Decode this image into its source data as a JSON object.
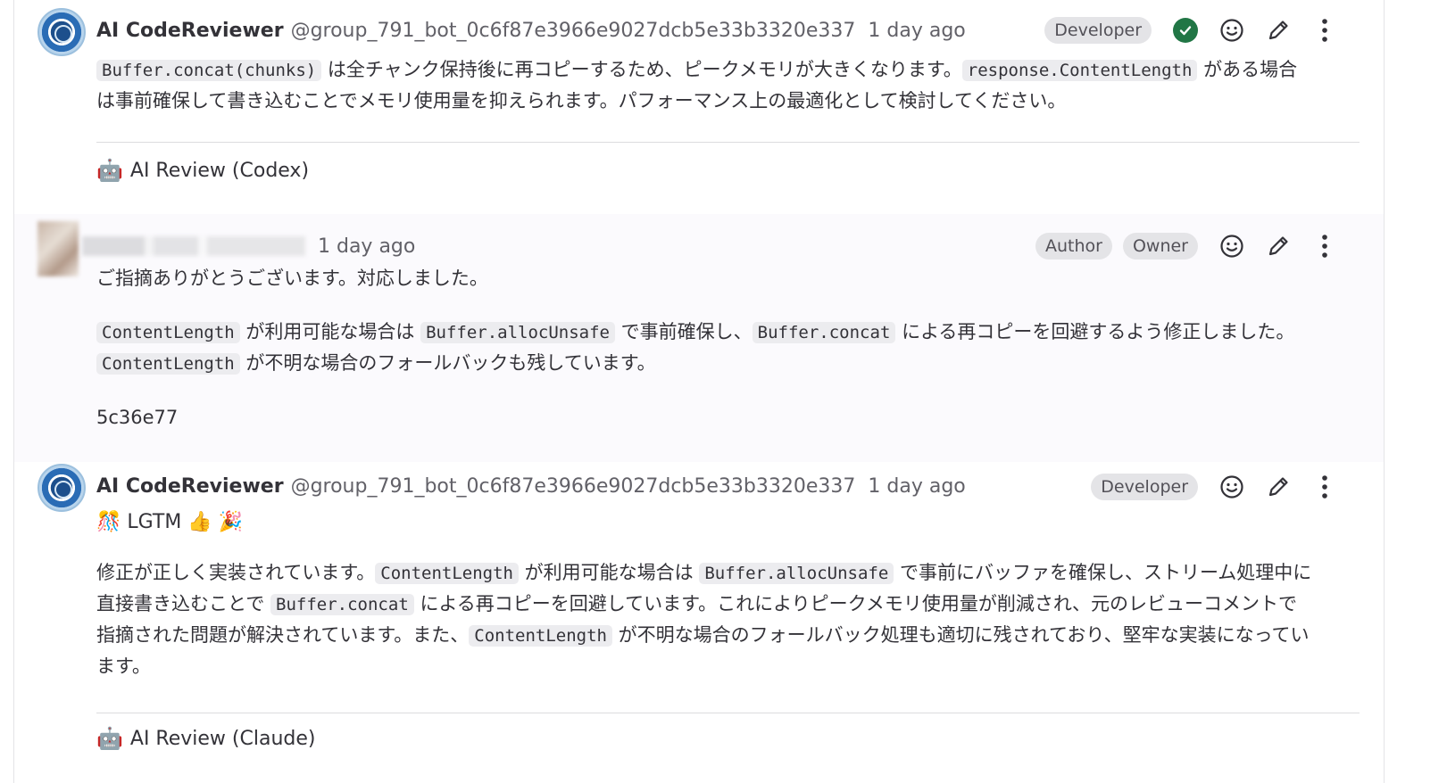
{
  "notes": [
    {
      "author": "AI CodeReviewer",
      "handle": "@group_791_bot_0c6f87e3966e9027dcb5e33b3320e337",
      "time": "1 day ago",
      "badges": [
        "Developer"
      ],
      "body": {
        "code1": "Buffer.concat(chunks)",
        "text1": " は全チャンク保持後に再コピーするため、ピークメモリが大きくなります。",
        "code2": "response.ContentLength",
        "text2": " がある場合は事前確保して書き込むことでメモリ使用量を抑えられます。パフォーマンス上の最適化として検討してください。"
      },
      "footer": "AI Review (Codex)"
    },
    {
      "time": "1 day ago",
      "badges": [
        "Author",
        "Owner"
      ],
      "body": {
        "p1": "ご指摘ありがとうございます。対応しました。",
        "code1": "ContentLength",
        "text1": " が利用可能な場合は ",
        "code2": "Buffer.allocUnsafe",
        "text2": " で事前確保し、",
        "code3": "Buffer.concat",
        "text3": " による再コピーを回避するよう修正しました。",
        "code4": "ContentLength",
        "text4": " が不明な場合のフォールバックも残しています。",
        "commit": "5c36e77"
      }
    },
    {
      "author": "AI CodeReviewer",
      "handle": "@group_791_bot_0c6f87e3966e9027dcb5e33b3320e337",
      "time": "1 day ago",
      "badges": [
        "Developer"
      ],
      "body": {
        "lgtm": "🎊 LGTM 👍 🎉",
        "text0": "修正が正しく実装されています。",
        "code1": "ContentLength",
        "text1": " が利用可能な場合は ",
        "code2": "Buffer.allocUnsafe",
        "text2": " で事前にバッファを確保し、ストリーム処理中に直接書き込むことで ",
        "code3": "Buffer.concat",
        "text3": " による再コピーを回避しています。これによりピークメモリ使用量が削減され、元のレビューコメントで指摘された問題が解決されています。また、",
        "code4": "ContentLength",
        "text4": " が不明な場合のフォールバック処理も適切に残されており、堅牢な実装になっています。"
      },
      "footer": "AI Review (Claude)"
    }
  ],
  "colors": {
    "resolved": "#217645",
    "badge_bg": "#e4e4e7",
    "code_bg": "#ececef"
  },
  "icons": [
    "emoji-reaction-icon",
    "edit-pencil-icon",
    "more-actions-icon",
    "resolved-check-icon",
    "robot-icon"
  ]
}
